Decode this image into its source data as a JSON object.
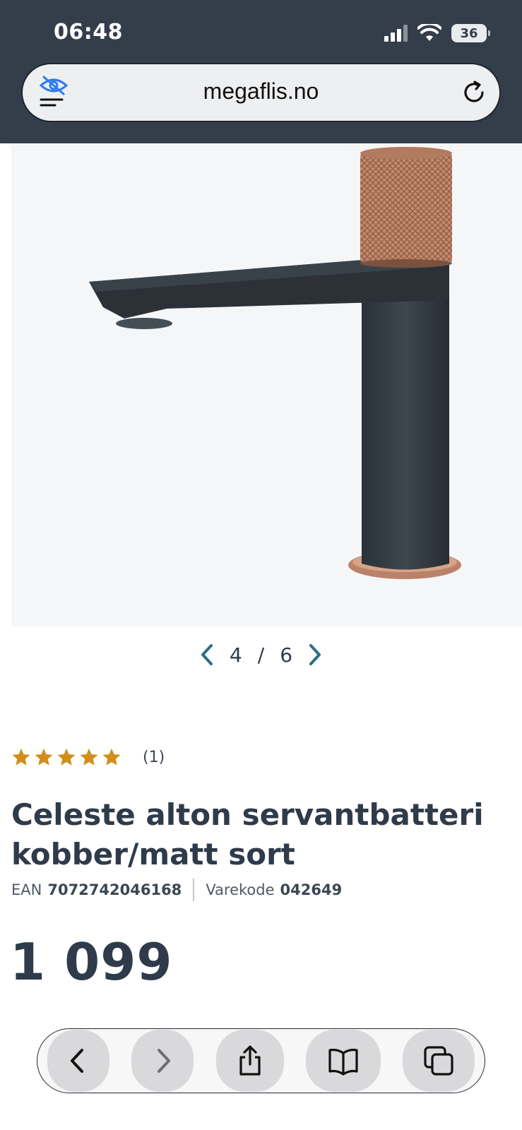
{
  "status_bar": {
    "time": "06:48",
    "battery": "36",
    "icons": [
      "cellular-signal-icon",
      "wifi-icon",
      "battery-icon"
    ]
  },
  "address_bar": {
    "url": "megaflis.no",
    "left_icon": "privacy-eye-slash-icon",
    "right_icon": "reload-icon"
  },
  "product": {
    "image_alt": "faucet-product-image",
    "pager": {
      "current": "4",
      "separator": "/",
      "total": "6"
    },
    "rating": {
      "stars": 5,
      "count": "(1)"
    },
    "title": "Celeste alton servantbatteri kobber/matt sort",
    "ean_label": "EAN",
    "ean_value": "7072742046168",
    "code_label": "Varekode",
    "code_value": "042649",
    "price": "1 099"
  },
  "toolbar": {
    "buttons": [
      "back-icon",
      "forward-icon",
      "share-icon",
      "bookmarks-icon",
      "tabs-icon"
    ]
  },
  "colors": {
    "header_bg": "#343e4b",
    "star": "#d08f1b",
    "copper": "#c08a6a",
    "text": "#2f3b4a"
  }
}
